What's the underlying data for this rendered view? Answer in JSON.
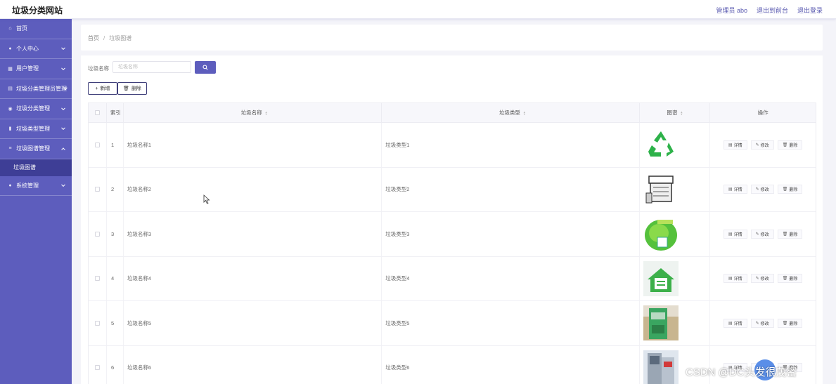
{
  "app": {
    "title": "垃圾分类网站"
  },
  "top_links": [
    {
      "label": "管理员 abo"
    },
    {
      "label": "退出到前台"
    },
    {
      "label": "退出登录"
    }
  ],
  "sidebar": {
    "items": [
      {
        "label": "首页",
        "icon": "home-icon"
      },
      {
        "label": "个人中心",
        "icon": "user-icon"
      },
      {
        "label": "用户管理",
        "icon": "grid-icon"
      },
      {
        "label": "垃圾分类管理员管理",
        "icon": "table-icon"
      },
      {
        "label": "垃圾分类管理",
        "icon": "pin-icon"
      },
      {
        "label": "垃圾类型管理",
        "icon": "chart-icon"
      },
      {
        "label": "垃圾图谱管理",
        "icon": "list-icon"
      },
      {
        "label": "系统管理",
        "icon": "user-icon"
      }
    ],
    "active_sub": "垃圾图谱"
  },
  "breadcrumb": {
    "home": "首页",
    "sep": "/",
    "current": "垃圾图谱"
  },
  "search": {
    "label": "垃圾名称",
    "placeholder": "垃圾名称",
    "value": ""
  },
  "toolbar": {
    "add_label": "新增",
    "delete_label": "删除"
  },
  "table": {
    "headers": {
      "index": "索引",
      "name": "垃圾名称",
      "type": "垃圾类型",
      "image": "图谱",
      "ops": "操作"
    },
    "rows": [
      {
        "index": "1",
        "name": "垃圾名称1",
        "type": "垃圾类型1",
        "image": "recycle-symbol"
      },
      {
        "index": "2",
        "name": "垃圾名称2",
        "type": "垃圾类型2",
        "image": "sketch-bin"
      },
      {
        "index": "3",
        "name": "垃圾名称3",
        "type": "垃圾类型3",
        "image": "green-leaf"
      },
      {
        "index": "4",
        "name": "垃圾名称4",
        "type": "垃圾类型4",
        "image": "green-house"
      },
      {
        "index": "5",
        "name": "垃圾名称5",
        "type": "垃圾类型5",
        "image": "green-bin"
      },
      {
        "index": "6",
        "name": "垃圾名称6",
        "type": "垃圾类型6",
        "image": "steel-cabinet"
      }
    ],
    "ops": {
      "detail": "详情",
      "edit": "修改",
      "delete": "删除"
    }
  },
  "watermark": "CSDN @DC头发很茂密",
  "colors": {
    "accent": "#5d5dbd",
    "sidebar_active": "#3e3e96",
    "recycle_green": "#2eb24a"
  }
}
